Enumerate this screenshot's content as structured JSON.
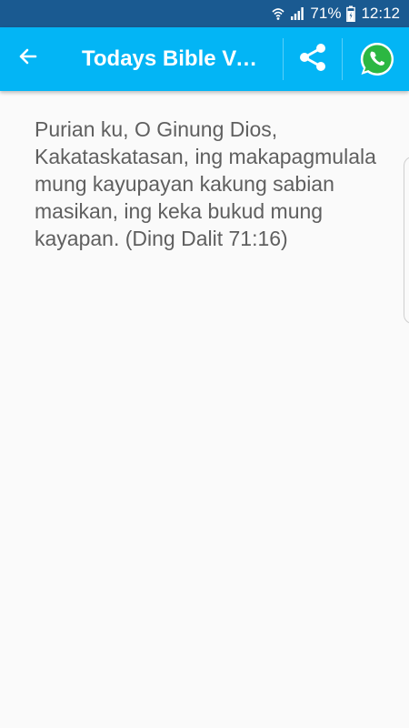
{
  "status_bar": {
    "battery_percent": "71%",
    "time": "12:12",
    "icons": [
      "wifi-icon",
      "signal-icon",
      "battery-icon"
    ]
  },
  "app_bar": {
    "title": "Todays Bible Ver...",
    "back_icon": "arrow-left-icon",
    "share_icon": "share-icon",
    "whatsapp_icon": "whatsapp-icon",
    "background_color": "#03b5f5"
  },
  "content": {
    "verse": "Purian ku, O Ginung Dios, Kakataskatasan, ing makapagmulala mung kayupayan kakung sabian masikan, ing keka bukud mung kayapan. (Ding Dalit 71:16)"
  },
  "colors": {
    "status_bar": "#1a5a91",
    "app_bar": "#03b5f5",
    "background": "#fafafa",
    "text": "#5f5f5f"
  }
}
